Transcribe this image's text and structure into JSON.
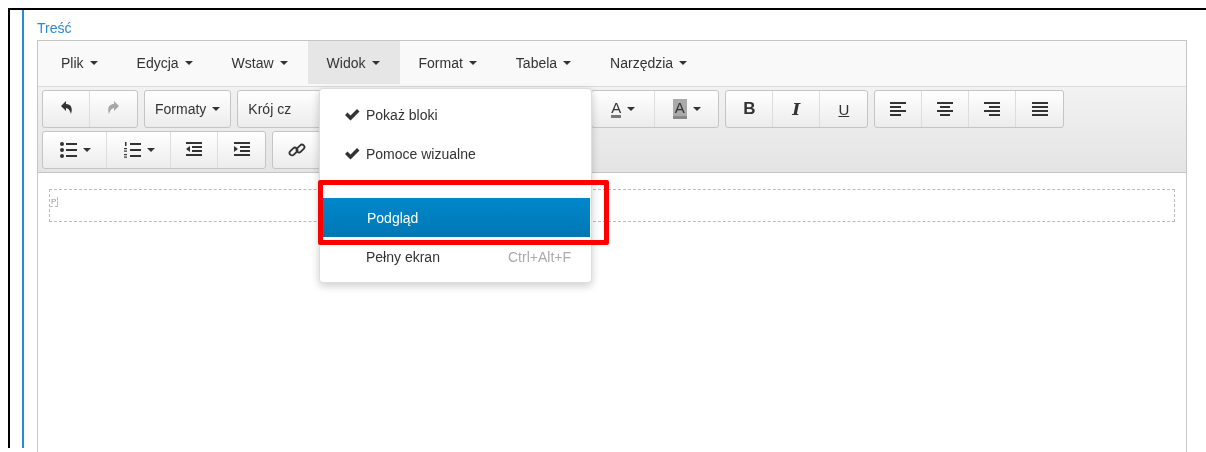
{
  "field_label": "Treść",
  "menubar": [
    {
      "label": "Plik",
      "selected": false
    },
    {
      "label": "Edycja",
      "selected": false
    },
    {
      "label": "Wstaw",
      "selected": false
    },
    {
      "label": "Widok",
      "selected": true
    },
    {
      "label": "Format",
      "selected": false
    },
    {
      "label": "Tabela",
      "selected": false
    },
    {
      "label": "Narzędzia",
      "selected": false
    }
  ],
  "toolbar": [
    [
      [
        {
          "kind": "undo",
          "disabled": false
        },
        {
          "kind": "redo",
          "disabled": true
        }
      ],
      [
        {
          "kind": "menu",
          "label": "Formaty",
          "disabled": false
        }
      ],
      [
        {
          "kind": "text",
          "label": "Krój cz",
          "disabled": false
        }
      ],
      [
        {
          "kind": "forecolor",
          "glyph": "A",
          "disabled": false
        },
        {
          "kind": "backcolor",
          "glyph": "A",
          "disabled": false
        }
      ],
      [
        {
          "kind": "bold",
          "glyph": "B",
          "disabled": false
        },
        {
          "kind": "italic",
          "glyph": "I",
          "disabled": false
        },
        {
          "kind": "underline",
          "glyph": "U",
          "disabled": false
        }
      ],
      [
        {
          "kind": "alignleft",
          "disabled": false
        },
        {
          "kind": "aligncenter",
          "disabled": false
        },
        {
          "kind": "alignright",
          "disabled": false
        },
        {
          "kind": "justify",
          "disabled": false
        }
      ]
    ],
    [
      [
        {
          "kind": "bullist",
          "disabled": false
        },
        {
          "kind": "numlist",
          "disabled": false
        },
        {
          "kind": "outdent",
          "disabled": false
        },
        {
          "kind": "indent",
          "disabled": false
        }
      ],
      [
        {
          "kind": "link",
          "disabled": false
        }
      ]
    ]
  ],
  "content": {
    "block_label": "P"
  },
  "dropdown": {
    "items": [
      {
        "kind": "check",
        "label": "Pokaż bloki",
        "checked": true,
        "selected": false
      },
      {
        "kind": "check",
        "label": "Pomoce wizualne",
        "checked": true,
        "selected": false
      },
      {
        "kind": "separator"
      },
      {
        "kind": "item",
        "label": "Podgląd",
        "selected": true
      },
      {
        "kind": "item",
        "label": "Pełny ekran",
        "shortcut": "Ctrl+Alt+F",
        "selected": false
      }
    ]
  },
  "annotation": {
    "kind": "frame"
  }
}
